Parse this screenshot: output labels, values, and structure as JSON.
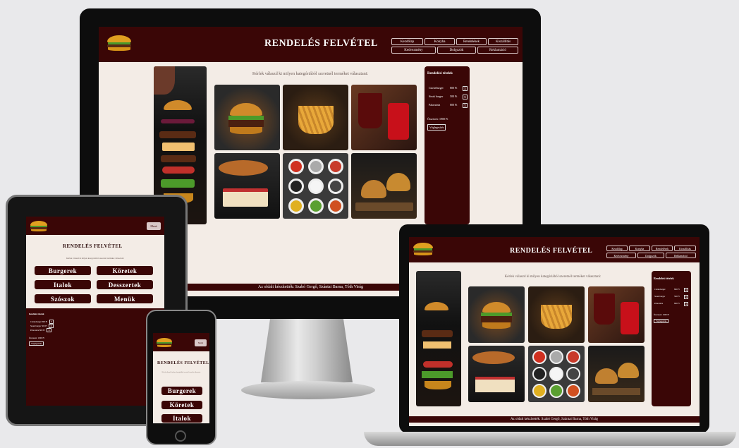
{
  "app": {
    "title": "RENDELÉS FELVÉTEL"
  },
  "nav": [
    "Kezdőlap",
    "Konyha",
    "Rendelések",
    "Kiszállítás",
    "Kedvezmény",
    "Dolgozók",
    "Reklamáció"
  ],
  "menu_button": "Menü",
  "intro_text": "Kérlek válaszd ki milyen kategóriából szeretnél terméket választani:",
  "tablet_intro": "Kérlek válaszd ki milyen kategóriából szeretnél terméket választani:",
  "categories": [
    "Burgerek",
    "Köretek",
    "Italok",
    "Desszertek",
    "Szószok",
    "Menük"
  ],
  "order": {
    "title": "Rendelési tételek",
    "items": [
      {
        "name": "Csirkeburger",
        "price": "800 Ft",
        "remove": "X"
      },
      {
        "name": "Steak burger",
        "price": "500 Ft",
        "remove": "X"
      },
      {
        "name": "Palacsinta",
        "price": "800 Ft",
        "remove": "X"
      }
    ],
    "total": "Összesen: 1900 Ft",
    "finish": "Véglegesítés"
  },
  "footer": "Az oldalt készítették: Szabó Gergő, Szántai Barna, Tóth Virág",
  "colors": {
    "header": "#3a0606",
    "page": "#f3ece6",
    "accent": "#e0a020"
  }
}
